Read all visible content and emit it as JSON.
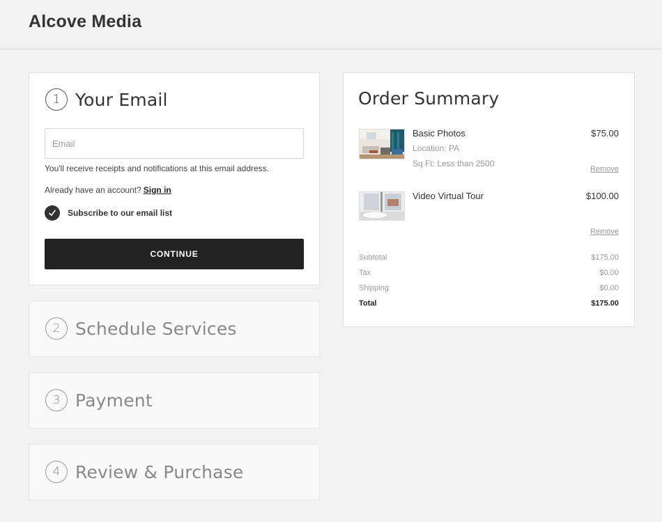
{
  "brand": "Alcove Media",
  "steps": [
    {
      "num": "1",
      "title": "Your Email"
    },
    {
      "num": "2",
      "title": "Schedule Services"
    },
    {
      "num": "3",
      "title": "Payment"
    },
    {
      "num": "4",
      "title": "Review & Purchase"
    }
  ],
  "email": {
    "placeholder": "Email",
    "value": "",
    "hint": "You'll receive receipts and notifications at this email address.",
    "account_prompt": "Already have an account?",
    "sign_in": "Sign in",
    "subscribe_label": "Subscribe to our email list",
    "subscribed": true,
    "continue_label": "CONTINUE"
  },
  "summary": {
    "title": "Order Summary",
    "items": [
      {
        "name": "Basic Photos",
        "price": "$75.00",
        "details": [
          "Location: PA",
          "Sq Ft: Less than 2500"
        ],
        "remove": "Remove",
        "thumb_icon": "living-room-photo"
      },
      {
        "name": "Video Virtual Tour",
        "price": "$100.00",
        "details": [],
        "remove": "Remove",
        "thumb_icon": "bathroom-photo"
      }
    ],
    "totals": [
      {
        "label": "Subtotal",
        "value": "$175.00"
      },
      {
        "label": "Tax",
        "value": "$0.00"
      },
      {
        "label": "Shipping",
        "value": "$0.00"
      },
      {
        "label": "Total",
        "value": "$175.00"
      }
    ]
  }
}
